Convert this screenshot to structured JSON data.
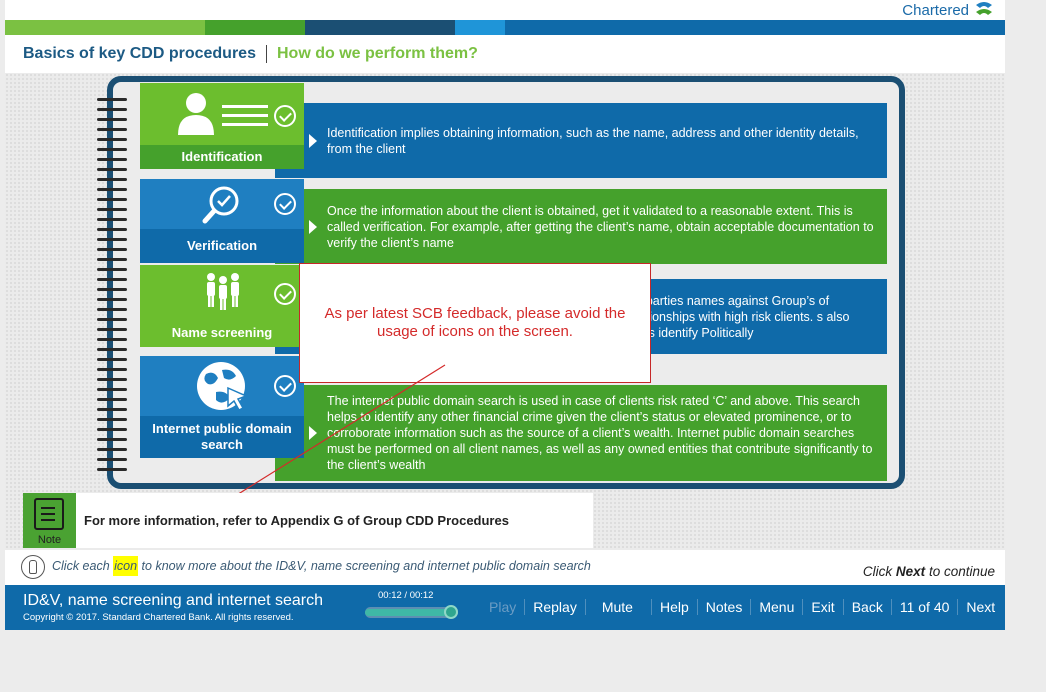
{
  "brand": {
    "name": "Chartered"
  },
  "colors": {
    "top_bar": [
      "#7bc142",
      "#45a12c",
      "#1b4f73",
      "#1f95d8",
      "#0f6aa9"
    ]
  },
  "header": {
    "title": "Basics of key CDD procedures",
    "subtitle": "How do we perform them?"
  },
  "cards": [
    {
      "label": "Identification",
      "icon": "person-card-icon",
      "panel_text": "Identification implies obtaining information, such as the name, address and other identity details, from the client"
    },
    {
      "label": "Verification",
      "icon": "magnifier-check-icon",
      "panel_text": "Once the information about the client is obtained, get it validated to a reasonable extent. This is called verification. For example, after getting the client’s name, obtain acceptable documentation to verify the client’s name"
    },
    {
      "label": "Name screening",
      "icon": "people-group-icon",
      "panel_text": "ted parties names against Group’s of relationships with high risk clients. s also helps identify Politically"
    },
    {
      "label": "Internet public domain search",
      "icon": "globe-cursor-icon",
      "panel_text": "The internet public domain search is used in case of clients risk rated ‘C’ and above. This search helps to identify any other financial crime given the client’s status or elevated prominence, or to corroborate information such as the source of a client’s wealth. Internet public domain searches must be performed on all client names, as well as any owned entities that contribute significantly to the client’s wealth"
    }
  ],
  "callout": {
    "text": "As per latest SCB feedback, please avoid the usage of icons on the screen."
  },
  "note": {
    "label": "Note",
    "text": "For more information, refer to Appendix G of Group CDD Procedures"
  },
  "instruction": {
    "before": "Click each ",
    "highlight": "icon",
    "after": " to know more about the ID&V, name screening and internet public domain search"
  },
  "continue": {
    "prefix": "Click ",
    "bold": "Next",
    "suffix": " to continue"
  },
  "footer": {
    "title": "ID&V, name screening and internet search",
    "copyright": "Copyright © 2017. Standard Chartered Bank. All rights reserved.",
    "time": "00:12 / 00:12",
    "progress": 1.0,
    "nav": {
      "play": "Play",
      "replay": "Replay",
      "mute": "Mute",
      "help": "Help",
      "notes": "Notes",
      "menu": "Menu",
      "exit": "Exit",
      "back": "Back",
      "page": "11 of 40",
      "next": "Next"
    }
  }
}
